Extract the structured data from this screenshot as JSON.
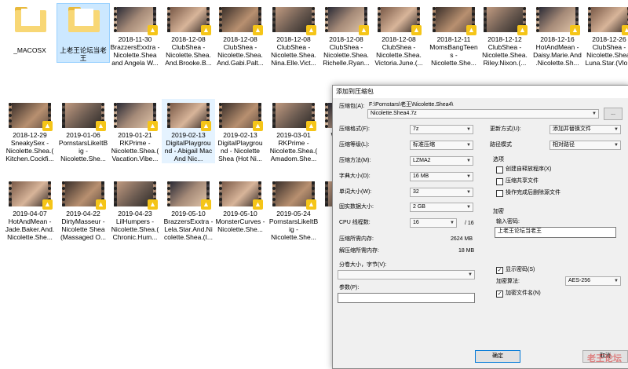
{
  "explorer": {
    "items": [
      {
        "label": "_MACOSX",
        "kind": "folder"
      },
      {
        "label": "上老王论坛当老王",
        "kind": "folder"
      },
      {
        "label": "2018-11-30 BrazzersExxtra - Nicolette.Shea and Angela W...",
        "kind": "video"
      },
      {
        "label": "2018-12-08 ClubShea - Nicolette.Shea. And.Brooke.B...",
        "kind": "video"
      },
      {
        "label": "2018-12-08 ClubShea - Nicolette.Shea. And.Gabi.Palt...",
        "kind": "video"
      },
      {
        "label": "2018-12-08 ClubShea - Nicolette.Shea. Nina.Elle.Vict...",
        "kind": "video"
      },
      {
        "label": "2018-12-08 ClubShea - Nicolette.Shea. Richelle.Ryan...",
        "kind": "video"
      },
      {
        "label": "2018-12-08 ClubShea - Nicolette.Shea. Victoria.June.(...",
        "kind": "video"
      },
      {
        "label": "2018-12-11 MomsBangTeens - Nicolette.She...",
        "kind": "video"
      },
      {
        "label": "2018-12-12 ClubShea - Nicolette.Shea. Riley.Nixon.(...",
        "kind": "video"
      },
      {
        "label": "2018-12-16 HotAndMean - Daisy.Marie.And .Nicolette.Sh...",
        "kind": "video"
      },
      {
        "label": "2018-12-26 ClubShea - Nicolette.Shea. Luna.Star.(Vlo...",
        "kind": "video"
      },
      {
        "label": "2018-12-29 SneakySex - Nicolette.Shea.( Kitchen.Cockfi...",
        "kind": "video"
      },
      {
        "label": "2019-01-06 PornstarsLikeItB ig - Nicolette.She...",
        "kind": "video"
      },
      {
        "label": "2019-01-21 RKPrime - Nicolette.Shea.( Vacation.Vibe...",
        "kind": "video"
      },
      {
        "label": "2019-02-13 DigitalPlaygrou nd - Abigail Mac And Nic...",
        "kind": "video"
      },
      {
        "label": "2019-02-13 DigitalPlaygrou nd - Nicolette Shea (Hot Ni...",
        "kind": "video"
      },
      {
        "label": "2019-03-01 RKPrime - Nicolette.Shea.( Amadom.She...",
        "kind": "video"
      },
      {
        "label": "Whe Nicol",
        "kind": "video"
      },
      {
        "label": "2019-04-07 HotAndMean - Jade.Baker.And. Nicolette.She...",
        "kind": "video"
      },
      {
        "label": "2019-04-22 DirtyMasseur - Nicolette Shea (Massaged O...",
        "kind": "video"
      },
      {
        "label": "2019-04-23 LilHumpers - Nicolette.Shea.( Chronic.Hum...",
        "kind": "video"
      },
      {
        "label": "2019-05-10 BrazzersExxtra - Lela.Star.And.Ni colette.Shea.(I...",
        "kind": "video"
      },
      {
        "label": "2019-05-10 MonsterCurves - Nicolette.She...",
        "kind": "video"
      },
      {
        "label": "2019-05-24 PornstarsLikeItB ig - Nicolette.She...",
        "kind": "video"
      },
      {
        "label": "Nicol",
        "kind": "video"
      }
    ]
  },
  "dialog": {
    "title": "添加到压缩包",
    "archive_label": "压缩包(A):",
    "archive_path": "F:\\Pornstars\\老王\\Nicolette.Shea4\\",
    "archive_name": "Nicolette.Shea4.7z",
    "browse": "...",
    "format_label": "压缩格式(F):",
    "format_value": "7z",
    "level_label": "压缩等级(L):",
    "level_value": "标准压缩",
    "method_label": "压缩方法(M):",
    "method_value": "LZMA2",
    "dict_label": "字典大小(D):",
    "dict_value": "16 MB",
    "word_label": "单词大小(W):",
    "word_value": "32",
    "block_label": "固实数据大小:",
    "block_value": "2 GB",
    "cpu_label": "CPU 线程数:",
    "cpu_value": "16",
    "cpu_total": "/ 16",
    "mem_comp_label": "压缩所需内存:",
    "mem_comp_value": "2624 MB",
    "mem_decomp_label": "解压缩所需内存:",
    "mem_decomp_value": "18 MB",
    "split_label": "分卷大小，字节(V):",
    "params_label": "参数(P):",
    "update_label": "更新方式(U):",
    "update_value": "添加并替换文件",
    "path_label": "路径模式",
    "path_value": "相对路径",
    "options_title": "选项",
    "opt_sfx": "创建自释放程序(X)",
    "opt_shared": "压缩共享文件",
    "opt_delete": "操作完成后删除源文件",
    "encrypt_title": "加密",
    "password_label": "输入密码:",
    "password_value": "上老王论坛当老王",
    "show_password": "显示密码(S)",
    "enc_method_label": "加密算法:",
    "enc_method_value": "AES-256",
    "enc_names": "加密文件名(N)",
    "ok": "确定",
    "cancel": "取消"
  },
  "watermark": "老王论坛"
}
